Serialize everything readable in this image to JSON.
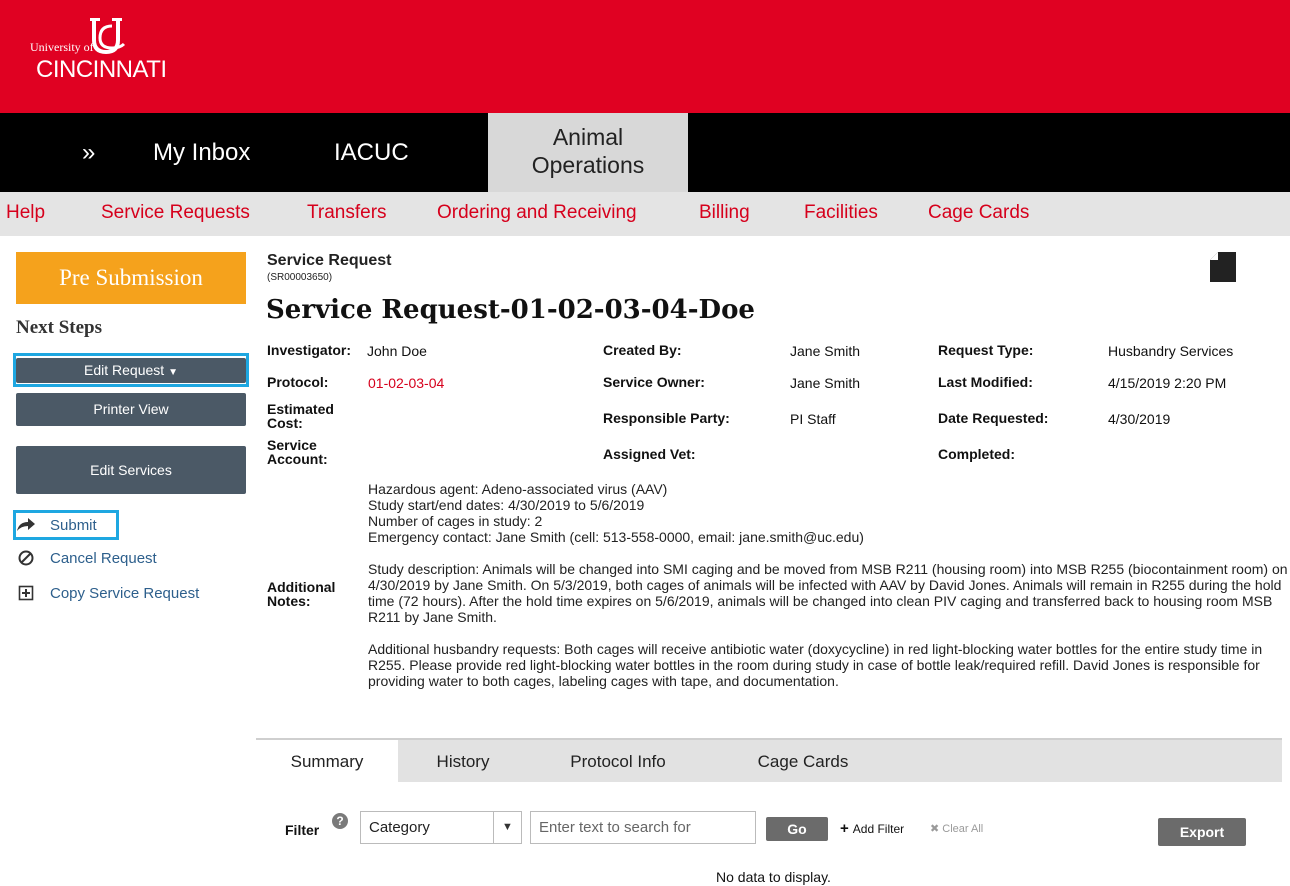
{
  "brand": {
    "university_of": "University of",
    "cincinnati": "CINCINNATI",
    "colors": {
      "primary": "#e00122",
      "nav": "#000000",
      "accent": "#f5a21c",
      "link": "#d6001c",
      "highlight": "#1ea7e1"
    }
  },
  "nav": {
    "expand": "»",
    "inbox": "My Inbox",
    "iacuc": "IACUC",
    "active_line1": "Animal",
    "active_line2": "Operations"
  },
  "subnav": {
    "items": [
      "Help",
      "Service Requests",
      "Transfers",
      "Ordering and Receiving",
      "Billing",
      "Facilities",
      "Cage Cards"
    ]
  },
  "sidebar": {
    "status": "Pre Submission",
    "next_steps": "Next Steps",
    "edit_request": "Edit Request",
    "printer_view": "Printer View",
    "edit_services": "Edit Services",
    "submit": "Submit",
    "cancel_request": "Cancel Request",
    "copy_request": "Copy Service Request",
    "icons": {
      "submit": "share-arrow-icon",
      "cancel": "cancel-circle-icon",
      "copy": "copy-plus-icon"
    }
  },
  "request": {
    "label": "Service Request",
    "id": "(SR00003650)",
    "title": "Service Request-01-02-03-04-Doe",
    "fields": {
      "investigator_label": "Investigator:",
      "investigator": "John Doe",
      "protocol_label": "Protocol:",
      "protocol": "01-02-03-04",
      "estimated_cost_label": "Estimated Cost:",
      "service_account_label": "Service Account:",
      "created_by_label": "Created By:",
      "created_by": "Jane Smith",
      "service_owner_label": "Service Owner:",
      "service_owner": "Jane Smith",
      "responsible_party_label": "Responsible Party:",
      "responsible_party": "PI Staff",
      "assigned_vet_label": "Assigned Vet:",
      "request_type_label": "Request Type:",
      "request_type": "Husbandry Services",
      "last_modified_label": "Last Modified:",
      "last_modified": "4/15/2019 2:20 PM",
      "date_requested_label": "Date Requested:",
      "date_requested": "4/30/2019",
      "completed_label": "Completed:"
    },
    "additional_notes_label": "Additional Notes:",
    "notes": [
      "Hazardous agent: Adeno-associated virus (AAV)",
      "Study start/end dates: 4/30/2019 to 5/6/2019",
      "Number of cages in study: 2",
      "Emergency contact: Jane Smith (cell: 513-558-0000, email: jane.smith@uc.edu)",
      "Study description: Animals will be changed into SMI caging and be moved from MSB R211 (housing room) into MSB R255 (biocontainment room) on 4/30/2019 by Jane Smith. On 5/3/2019, both cages of animals will be infected with AAV by David Jones. Animals will remain in R255 during the hold time (72 hours). After the hold time expires on 5/6/2019, animals will be changed into clean PIV caging and transferred back to housing room MSB R211 by Jane Smith.",
      "Additional husbandry requests: Both cages will receive antibiotic water (doxycycline) in red light-blocking water bottles for the entire study time in R255. Please provide red light-blocking water bottles in the room during study in case of bottle leak/required refill. David Jones is responsible for providing water to both cages, labeling cages with tape, and documentation."
    ]
  },
  "tabs": [
    "Summary",
    "History",
    "Protocol Info",
    "Cage Cards"
  ],
  "filter": {
    "label": "Filter",
    "help": "?",
    "category": "Category",
    "search_placeholder": "Enter text to search for",
    "go": "Go",
    "add_filter": "Add Filter",
    "clear_all": "Clear All",
    "export": "Export",
    "no_data": "No data to display."
  }
}
